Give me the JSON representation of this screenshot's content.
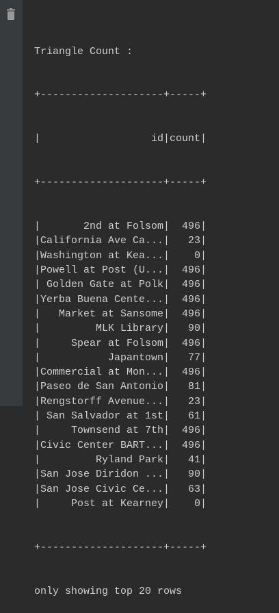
{
  "output": {
    "title": "Triangle Count :",
    "border": "+--------------------+-----+",
    "columns": [
      "id",
      "count"
    ],
    "rows": [
      {
        "id": "2nd at Folsom",
        "count": 496
      },
      {
        "id": "California Ave Ca...",
        "count": 23
      },
      {
        "id": "Washington at Kea...",
        "count": 0
      },
      {
        "id": "Powell at Post (U...",
        "count": 496
      },
      {
        "id": "Golden Gate at Polk",
        "count": 496
      },
      {
        "id": "Yerba Buena Cente...",
        "count": 496
      },
      {
        "id": "Market at Sansome",
        "count": 496
      },
      {
        "id": "MLK Library",
        "count": 90
      },
      {
        "id": "Spear at Folsom",
        "count": 496
      },
      {
        "id": "Japantown",
        "count": 77
      },
      {
        "id": "Commercial at Mon...",
        "count": 496
      },
      {
        "id": "Paseo de San Antonio",
        "count": 81
      },
      {
        "id": "Rengstorff Avenue...",
        "count": 23
      },
      {
        "id": "San Salvador at 1st",
        "count": 61
      },
      {
        "id": "Townsend at 7th",
        "count": 496
      },
      {
        "id": "Civic Center BART...",
        "count": 496
      },
      {
        "id": "Ryland Park",
        "count": 41
      },
      {
        "id": "San Jose Diridon ...",
        "count": 90
      },
      {
        "id": "San Jose Civic Ce...",
        "count": 63
      },
      {
        "id": "Post at Kearney",
        "count": 0
      }
    ],
    "footer": "only showing top 20 rows"
  },
  "icons": {
    "delete": "trash-icon"
  }
}
